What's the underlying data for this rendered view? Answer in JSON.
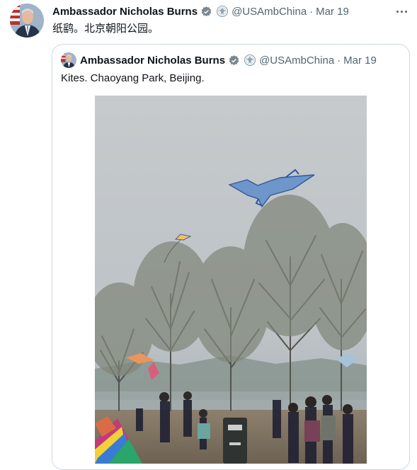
{
  "tweet": {
    "author_name": "Ambassador Nicholas Burns",
    "handle": "@USAmbChina",
    "separator": "·",
    "date": "Mar 19",
    "text": "纸鹞。北京朝阳公园。",
    "more_icon": "more-horizontal-icon"
  },
  "quoted_tweet": {
    "author_name": "Ambassador Nicholas Burns",
    "handle": "@USAmbChina",
    "separator": "·",
    "date": "Mar 19",
    "text": "Kites.  Chaoyang Park, Beijing."
  },
  "icons": {
    "verified": "verified-badge-icon",
    "affiliation": "us-embassy-seal-icon"
  },
  "colors": {
    "verified_badge": "#7a8790",
    "muted_text": "#536471",
    "border": "#cfd9de"
  }
}
